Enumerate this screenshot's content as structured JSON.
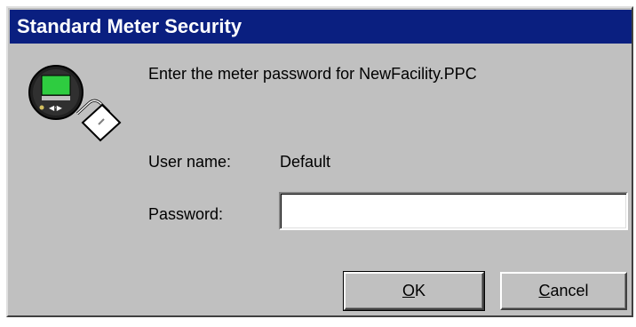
{
  "window": {
    "title": "Standard Meter Security"
  },
  "icon": {
    "name": "meter-lock-icon"
  },
  "dialog": {
    "prompt": "Enter the meter password for NewFacility.PPC",
    "user_label": "User name:",
    "user_value": "Default",
    "password_label": "Password:",
    "password_value": "",
    "ok_label_mnemonic": "O",
    "ok_label_rest": "K",
    "cancel_label_mnemonic": "C",
    "cancel_label_rest": "ancel"
  },
  "colors": {
    "titlebar": "#0a1f80",
    "face": "#c0c0c0",
    "meter_display": "#2ecc40"
  }
}
